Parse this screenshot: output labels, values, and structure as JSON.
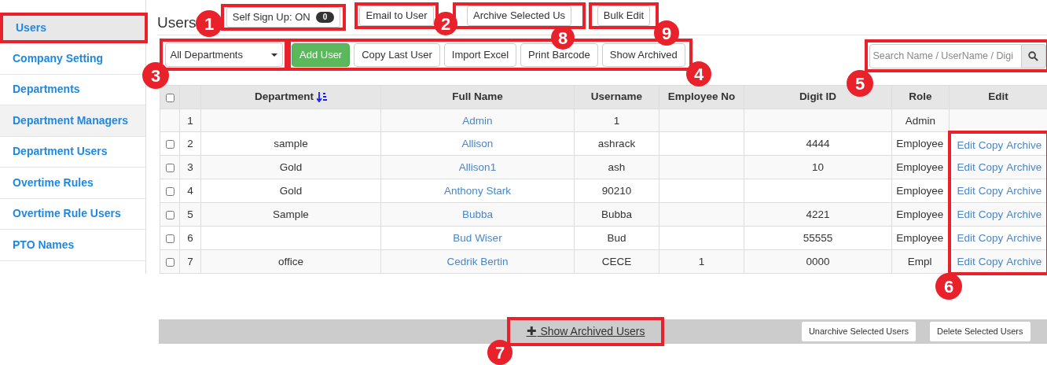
{
  "sidebar": {
    "items": [
      {
        "label": "Users",
        "selected": true
      },
      {
        "label": "Company Setting",
        "selected": false,
        "hover": false
      },
      {
        "label": "Departments",
        "selected": false,
        "hover": false
      },
      {
        "label": "Department Managers",
        "selected": false,
        "hover": true
      },
      {
        "label": "Department Users",
        "selected": false,
        "hover": false
      },
      {
        "label": "Overtime Rules",
        "selected": false,
        "hover": false
      },
      {
        "label": "Overtime Rule Users",
        "selected": false,
        "hover": false
      },
      {
        "label": "PTO Names",
        "selected": false,
        "hover": false
      }
    ]
  },
  "page_title": "Users",
  "top_buttons": [
    {
      "label": "Self Sign Up: ON",
      "badge": "0"
    },
    {
      "label": "Email to User"
    },
    {
      "label": "Archive Selected Us"
    },
    {
      "label": "Bulk Edit"
    }
  ],
  "department_select": {
    "value": "All Departments"
  },
  "toolbar_buttons": [
    {
      "label": "Add User",
      "kind": "primary"
    },
    {
      "label": "Copy Last User",
      "kind": "default"
    },
    {
      "label": "Import Excel",
      "kind": "default"
    },
    {
      "label": "Print Barcode",
      "kind": "default"
    },
    {
      "label": "Show Archived",
      "kind": "default"
    }
  ],
  "search": {
    "placeholder": "Search Name / UserName / Digi"
  },
  "table": {
    "select_all_checked": false,
    "columns": [
      {
        "label": "Department",
        "sorted": true
      },
      {
        "label": "Full Name",
        "sorted": false
      },
      {
        "label": "Username",
        "sorted": false
      },
      {
        "label": "Employee No",
        "sorted": false
      },
      {
        "label": "Digit ID",
        "sorted": false
      },
      {
        "label": "Role",
        "sorted": false
      },
      {
        "label": "Edit",
        "sorted": false
      }
    ],
    "rows": [
      {
        "index": "1",
        "department": "",
        "full_name": "Admin",
        "username": "1",
        "employee_no": "",
        "digit_id": "",
        "role": "Admin",
        "actions": []
      },
      {
        "checked": false,
        "index": "2",
        "department": "sample",
        "full_name": "Allison",
        "username": "ashrack",
        "employee_no": "",
        "digit_id": "4444",
        "role": "Employee",
        "actions": [
          "Edit",
          "Copy",
          "Archive"
        ]
      },
      {
        "checked": false,
        "index": "3",
        "department": "Gold",
        "full_name": "Allison1",
        "username": "ash",
        "employee_no": "",
        "digit_id": "10",
        "role": "Employee",
        "actions": [
          "Edit",
          "Copy",
          "Archive"
        ]
      },
      {
        "checked": false,
        "index": "4",
        "department": "Gold",
        "full_name": "Anthony Stark",
        "username": "90210",
        "employee_no": "",
        "digit_id": "",
        "role": "Employee",
        "actions": [
          "Edit",
          "Copy",
          "Archive"
        ]
      },
      {
        "checked": false,
        "index": "5",
        "department": "Sample",
        "full_name": "Bubba",
        "username": "Bubba",
        "employee_no": "",
        "digit_id": "4221",
        "role": "Employee",
        "actions": [
          "Edit",
          "Copy",
          "Archive"
        ]
      },
      {
        "checked": false,
        "index": "6",
        "department": "",
        "full_name": "Bud Wiser",
        "username": "Bud",
        "employee_no": "",
        "digit_id": "55555",
        "role": "Employee",
        "actions": [
          "Edit",
          "Copy",
          "Archive"
        ]
      },
      {
        "checked": false,
        "index": "7",
        "department": "office",
        "full_name": "Cedrik Bertin",
        "username": "CECE",
        "employee_no": "1",
        "digit_id": "0000",
        "role": "Empl",
        "actions": [
          "Edit",
          "Copy",
          "Archive"
        ]
      }
    ]
  },
  "footer": {
    "toggle_icon": "✚",
    "toggle_label": " Show Archived Users",
    "buttons": [
      "Unarchive Selected Users",
      "Delete Selected Users"
    ]
  },
  "callouts": [
    "1",
    "2",
    "3",
    "4",
    "5",
    "6",
    "7",
    "8",
    "9"
  ]
}
